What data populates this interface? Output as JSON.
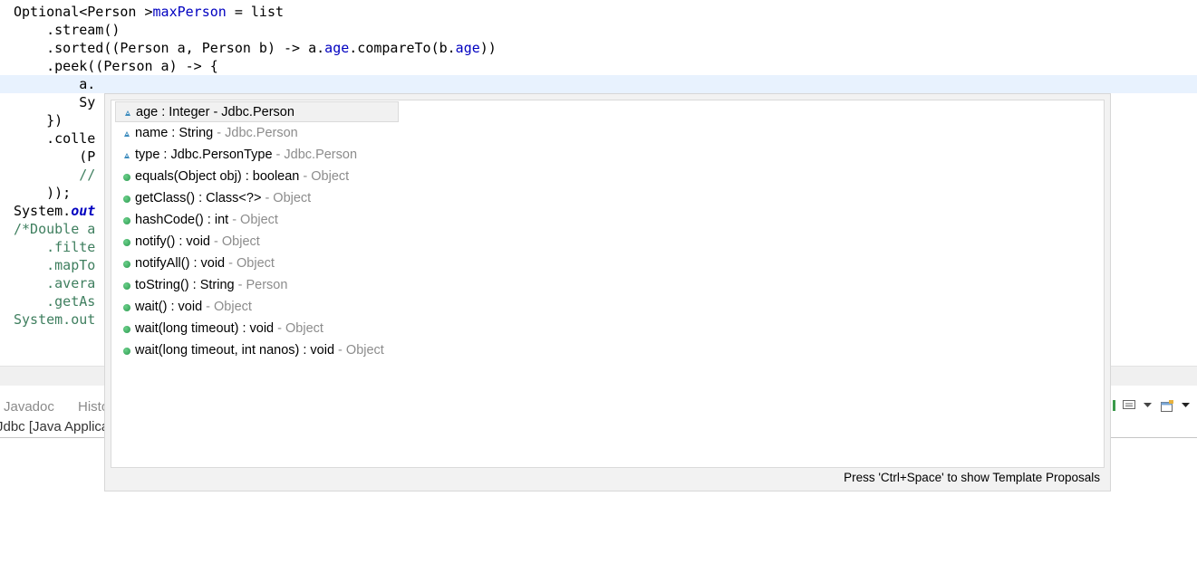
{
  "editor": {
    "lines": [
      {
        "segments": [
          {
            "t": "Optional<Person >",
            "c": ""
          },
          {
            "t": "maxPerson",
            "c": "fld"
          },
          {
            "t": " = list",
            "c": ""
          }
        ]
      },
      {
        "segments": [
          {
            "t": "    .stream()",
            "c": ""
          }
        ]
      },
      {
        "segments": [
          {
            "t": "    .sorted((Person a, Person b) -> a.",
            "c": ""
          },
          {
            "t": "age",
            "c": "fld"
          },
          {
            "t": ".compareTo(b.",
            "c": ""
          },
          {
            "t": "age",
            "c": "fld"
          },
          {
            "t": "))",
            "c": ""
          }
        ]
      },
      {
        "segments": [
          {
            "t": "    .peek((Person a) -> {",
            "c": ""
          }
        ]
      },
      {
        "segments": [
          {
            "t": "        a.",
            "c": ""
          }
        ],
        "current": true
      },
      {
        "segments": [
          {
            "t": "        Sy",
            "c": ""
          }
        ]
      },
      {
        "segments": [
          {
            "t": "    })",
            "c": ""
          }
        ]
      },
      {
        "segments": [
          {
            "t": "    .colle",
            "c": ""
          }
        ]
      },
      {
        "segments": [
          {
            "t": "        (P",
            "c": ""
          }
        ]
      },
      {
        "segments": [
          {
            "t": "        //",
            "c": "cm"
          }
        ]
      },
      {
        "segments": [
          {
            "t": "    ));",
            "c": ""
          }
        ]
      },
      {
        "segments": [
          {
            "t": "System.",
            "c": ""
          },
          {
            "t": "out",
            "c": "fld-static"
          }
        ]
      },
      {
        "segments": [
          {
            "t": "/*Double a",
            "c": "cm"
          }
        ]
      },
      {
        "segments": [
          {
            "t": "    .filte",
            "c": "cm"
          }
        ]
      },
      {
        "segments": [
          {
            "t": "    .mapTo",
            "c": "cm"
          }
        ]
      },
      {
        "segments": [
          {
            "t": "    .avera",
            "c": "cm"
          }
        ]
      },
      {
        "segments": [
          {
            "t": "    .getAs",
            "c": "cm"
          }
        ]
      },
      {
        "segments": [
          {
            "t": "System.out",
            "c": "cm"
          }
        ]
      }
    ]
  },
  "content_assist": {
    "proposals": [
      {
        "icon": "field-triangle-icon",
        "signature": "age : Integer",
        "owner": " - Jdbc.Person",
        "selected": true
      },
      {
        "icon": "field-triangle-icon",
        "signature": "name : String",
        "owner": " - Jdbc.Person"
      },
      {
        "icon": "field-triangle-icon",
        "signature": "type : Jdbc.PersonType",
        "owner": " - Jdbc.Person"
      },
      {
        "icon": "public-method-icon",
        "signature": "equals(Object obj) : boolean",
        "owner": " - Object"
      },
      {
        "icon": "public-method-icon",
        "signature": "getClass() : Class<?>",
        "owner": " - Object"
      },
      {
        "icon": "public-method-icon",
        "signature": "hashCode() : int",
        "owner": " - Object"
      },
      {
        "icon": "public-method-icon",
        "signature": "notify() : void",
        "owner": " - Object"
      },
      {
        "icon": "public-method-icon",
        "signature": "notifyAll() : void",
        "owner": " - Object"
      },
      {
        "icon": "public-method-icon",
        "signature": "toString() : String",
        "owner": " - Person"
      },
      {
        "icon": "public-method-icon",
        "signature": "wait() : void",
        "owner": " - Object"
      },
      {
        "icon": "public-method-icon",
        "signature": "wait(long timeout) : void",
        "owner": " - Object"
      },
      {
        "icon": "public-method-icon",
        "signature": "wait(long timeout, int nanos) : void",
        "owner": " - Object"
      }
    ],
    "status_text": "Press 'Ctrl+Space' to show Template Proposals"
  },
  "bottom_panel": {
    "tabs": [
      {
        "label": "Javadoc",
        "icon": "javadoc-icon"
      },
      {
        "label": "Histo",
        "icon": "history-icon"
      }
    ],
    "console_title": "Jdbc [Java Applicat",
    "toolbar_icons": [
      "display-selected-console-icon",
      "dropdown-arrow-icon",
      "open-console-icon",
      "view-menu-icon"
    ]
  }
}
